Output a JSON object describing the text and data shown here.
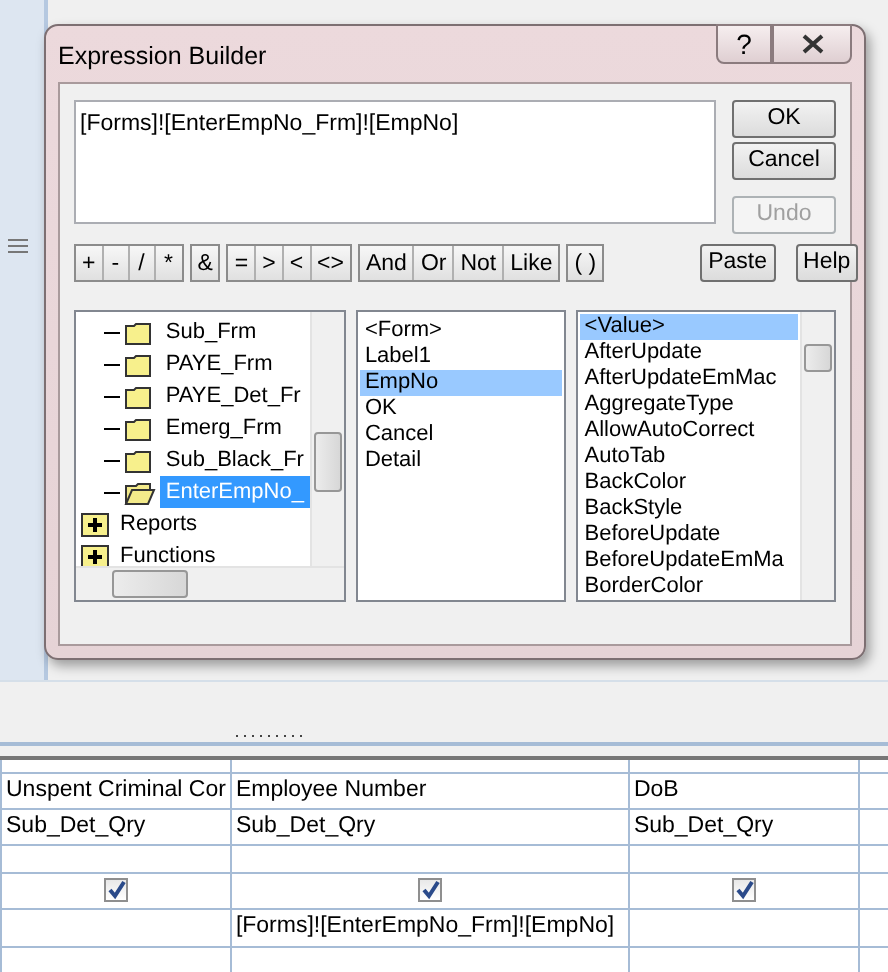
{
  "dialog": {
    "title": "Expression Builder",
    "help_glyph": "?",
    "expression": "[Forms]![EnterEmpNo_Frm]![EmpNo]",
    "side_buttons": [
      {
        "label": "OK",
        "disabled": false
      },
      {
        "label": "Cancel",
        "disabled": false
      },
      {
        "label": "Undo",
        "disabled": true
      }
    ],
    "operator_groups": [
      [
        "+",
        "-",
        "/",
        "*"
      ],
      [
        "&"
      ],
      [
        "=",
        ">",
        "<",
        "<>"
      ],
      [
        "And",
        "Or",
        "Not",
        "Like"
      ],
      [
        "( )"
      ]
    ],
    "paste_button": "Paste",
    "help_button": "Help",
    "tree": {
      "scrolled_branch": [
        {
          "label": "Sub_Frm",
          "open": false,
          "selected": false
        },
        {
          "label": "PAYE_Frm",
          "open": false,
          "selected": false
        },
        {
          "label": "PAYE_Det_Fr",
          "open": false,
          "selected": false
        },
        {
          "label": "Emerg_Frm",
          "open": false,
          "selected": false
        },
        {
          "label": "Sub_Black_Fr",
          "open": false,
          "selected": false
        },
        {
          "label": "EnterEmpNo_",
          "open": true,
          "selected": true
        }
      ],
      "root_items": [
        {
          "label": "Reports",
          "expanded": false
        },
        {
          "label": "Functions",
          "expanded": false
        }
      ]
    },
    "elements": [
      {
        "label": "<Form>",
        "selected": false
      },
      {
        "label": "Label1",
        "selected": false
      },
      {
        "label": "EmpNo",
        "selected": true
      },
      {
        "label": "OK",
        "selected": false
      },
      {
        "label": "Cancel",
        "selected": false
      },
      {
        "label": "Detail",
        "selected": false
      }
    ],
    "properties": [
      {
        "label": "<Value>",
        "selected": true
      },
      {
        "label": "AfterUpdate",
        "selected": false
      },
      {
        "label": "AfterUpdateEmMac",
        "selected": false
      },
      {
        "label": "AggregateType",
        "selected": false
      },
      {
        "label": "AllowAutoCorrect",
        "selected": false
      },
      {
        "label": "AutoTab",
        "selected": false
      },
      {
        "label": "BackColor",
        "selected": false
      },
      {
        "label": "BackStyle",
        "selected": false
      },
      {
        "label": "BeforeUpdate",
        "selected": false
      },
      {
        "label": "BeforeUpdateEmMa",
        "selected": false
      },
      {
        "label": "BorderColor",
        "selected": false
      }
    ]
  },
  "query_grid": {
    "columns": [
      {
        "field": "Unspent Criminal Cor",
        "table": "Sub_Det_Qry",
        "show": true
      },
      {
        "field": "Employee Number",
        "table": "Sub_Det_Qry",
        "show": true,
        "criteria": "[Forms]![EnterEmpNo_Frm]![EmpNo]"
      },
      {
        "field": "DoB",
        "table": "Sub_Det_Qry",
        "show": true
      }
    ]
  }
}
